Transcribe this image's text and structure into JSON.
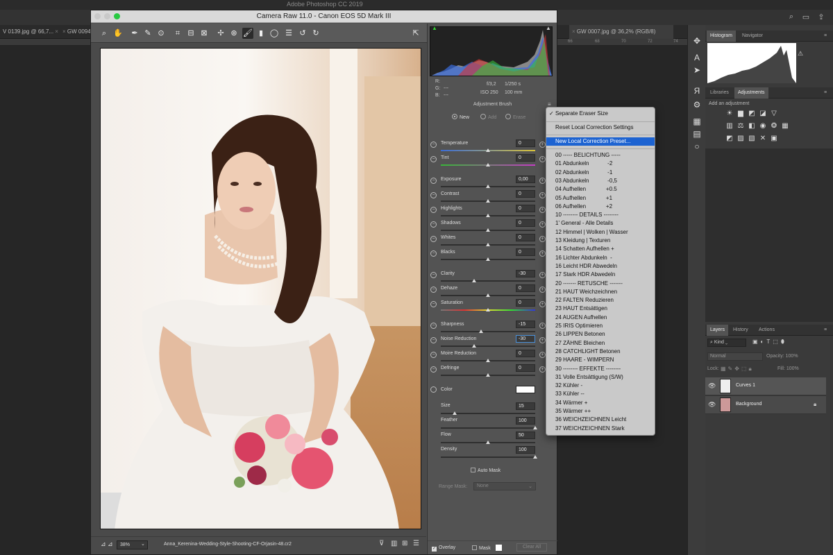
{
  "photoshop": {
    "app_title": "Adobe Photoshop CC 2019",
    "doc_tabs": [
      "V 0139.jpg @ 66,7...",
      "GW 0094",
      "GW 0007.jpg @ 36,2% (RGB/8)"
    ],
    "ruler_ticks": [
      "66",
      "68",
      "70",
      "72",
      "74"
    ],
    "panels": {
      "histogram_tab": "Histogram",
      "navigator_tab": "Navigator",
      "libraries_tab": "Libraries",
      "adjustments_tab": "Adjustments",
      "add_adjustment": "Add an adjustment",
      "layers_tab": "Layers",
      "history_tab": "History",
      "actions_tab": "Actions",
      "kind_label": "Kind",
      "blend_mode": "Normal",
      "opacity_label": "Opacity:",
      "opacity_value": "100%",
      "lock_label": "Lock:",
      "fill_label": "Fill:",
      "fill_value": "100%",
      "layers": [
        {
          "name": "Curves 1"
        },
        {
          "name": "Background"
        }
      ]
    }
  },
  "camera_raw": {
    "title": "Camera Raw 11.0  -  Canon EOS 5D Mark III",
    "exif": {
      "r_label": "R:",
      "g_label": "G:",
      "b_label": "B:",
      "rgb_value": "---",
      "aperture": "f/3,2",
      "shutter": "1/250 s",
      "iso": "ISO 250",
      "focal": "100 mm"
    },
    "panel_title": "Adjustment Brush",
    "modes": {
      "new": "New",
      "add": "Add",
      "erase": "Erase"
    },
    "sliders": [
      {
        "label": "Temperature",
        "value": "0",
        "pos": 0.5
      },
      {
        "label": "Tint",
        "value": "0",
        "pos": 0.5
      },
      {
        "label": "Exposure",
        "value": "0,00",
        "pos": 0.5
      },
      {
        "label": "Contrast",
        "value": "0",
        "pos": 0.5
      },
      {
        "label": "Highlights",
        "value": "0",
        "pos": 0.5
      },
      {
        "label": "Shadows",
        "value": "0",
        "pos": 0.5
      },
      {
        "label": "Whites",
        "value": "0",
        "pos": 0.5
      },
      {
        "label": "Blacks",
        "value": "0",
        "pos": 0.5
      },
      {
        "label": "Clarity",
        "value": "-30",
        "pos": 0.35
      },
      {
        "label": "Dehaze",
        "value": "0",
        "pos": 0.5
      },
      {
        "label": "Saturation",
        "value": "0",
        "pos": 0.5
      },
      {
        "label": "Sharpness",
        "value": "-15",
        "pos": 0.43
      },
      {
        "label": "Noise Reduction",
        "value": "-30",
        "pos": 0.35
      },
      {
        "label": "Moire Reduction",
        "value": "0",
        "pos": 0.5
      },
      {
        "label": "Defringe",
        "value": "0",
        "pos": 0.5
      }
    ],
    "color_label": "Color",
    "brush": [
      {
        "label": "Size",
        "value": "15",
        "pos": 0.15
      },
      {
        "label": "Feather",
        "value": "100",
        "pos": 1.0
      },
      {
        "label": "Flow",
        "value": "50",
        "pos": 0.5
      },
      {
        "label": "Density",
        "value": "100",
        "pos": 1.0
      }
    ],
    "auto_mask": "Auto Mask",
    "range_mask_label": "Range Mask:",
    "range_mask_value": "None",
    "overlay": "Overlay",
    "mask": "Mask",
    "clear_all": "Clear All",
    "zoom": "38%",
    "filename": "Anna_Kerenina-Wedding-Style-Shooting-CF-Orjasin-48.cr2"
  },
  "menu": {
    "separate_eraser": "Separate Eraser Size",
    "reset_local": "Reset Local Correction Settings",
    "new_local": "New Local Correction Preset...",
    "presets": [
      "00 ----- BELICHTUNG -----",
      "01 Abdunkeln            -2",
      "02 Abdunkeln            -1",
      "03 Abdunkeln            -0,5",
      "04 Aufhellen             +0.5",
      "05 Aufhellen             +1",
      "06 Aufhellen             +2",
      "10 -------- DETAILS --------",
      "1' General - Alle Details",
      "12 Himmel | Wolken | Wasser",
      "13 Kleidung | Texturen",
      "14 Schatten Aufhellen +",
      "16 Lichter Abdunkeln  -",
      "16 Leicht HDR Abwedeln",
      "17 Stark HDR Abwedeln",
      "20 ------- RETUSCHE -------",
      "21 HAUT Weichzeichnen",
      "22 FALTEN Reduzieren",
      "23 HAUT Entsättigen",
      "24 AUGEN Aufhellen",
      "25 IRIS Optimieren",
      "26 LIPPEN Betonen",
      "27 ZÄHNE Bleichen",
      "28 CATCHLIGHT Betonen",
      "29 HAARE - WIMPERN",
      "30 -------- EFFEKTE --------",
      "31 Volle Entsättigung (S/W)",
      "32 Kühler -",
      "33 Kühler --",
      "34 Wärmer +",
      "35 Wärmer ++",
      "36 WEICHZEICHNEN Leicht",
      "37 WEICHZEICHNEN Stark"
    ]
  }
}
